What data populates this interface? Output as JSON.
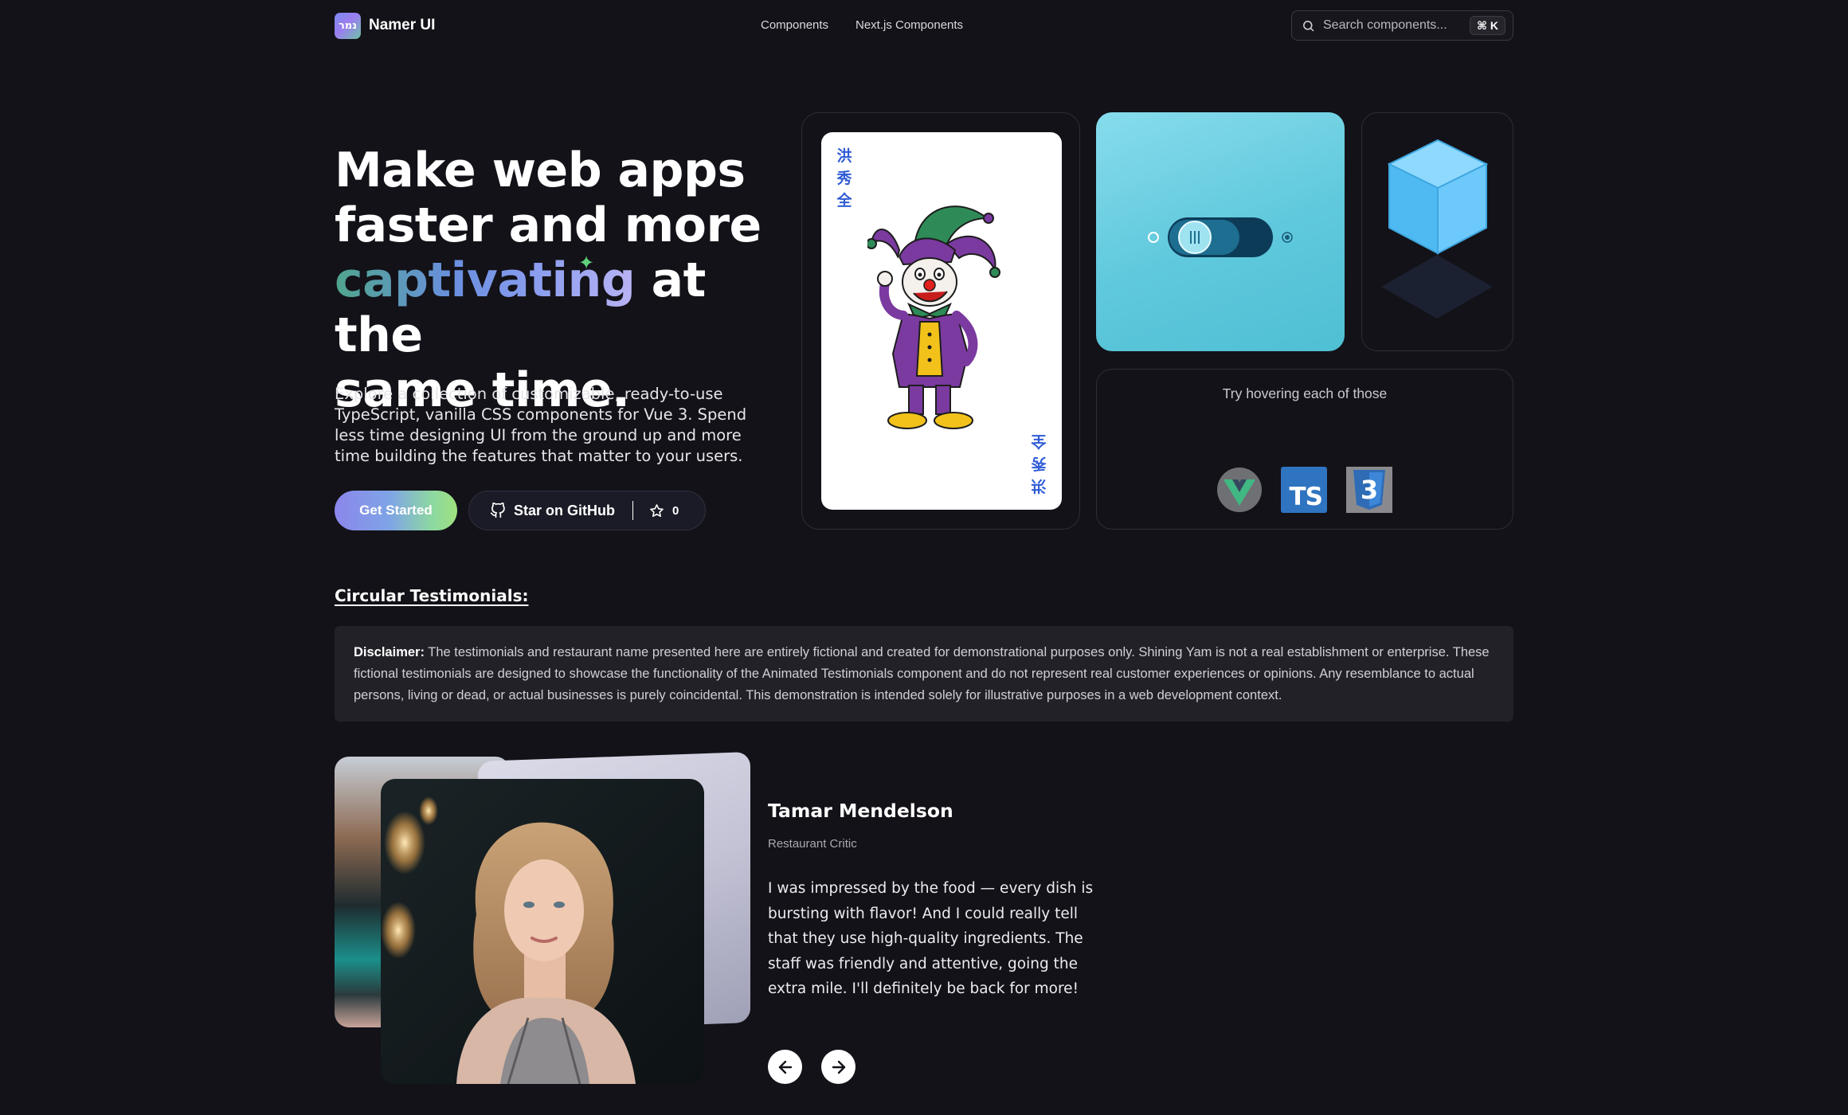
{
  "header": {
    "logo_glyph": "נמר",
    "brand": "Namer UI",
    "nav": [
      "Components",
      "Next.js Components"
    ],
    "search": {
      "placeholder": "Search components...",
      "shortcut": "⌘ K"
    }
  },
  "hero": {
    "title_line1": "Make web apps",
    "title_line2": "faster and more",
    "title_highlight": "captivating",
    "title_line3_rest": " at the",
    "title_line4": "same time.",
    "description": "Explore a collection of customizable, ready-to-use TypeScript, vanilla CSS components for Vue 3. Spend less time designing UI from the ground up and more time building the features that matter to your users.",
    "primary_button": "Get Started",
    "github_button": "Star on GitHub",
    "star_count": "0"
  },
  "showcase": {
    "card_top_chars": [
      "洪",
      "秀",
      "全"
    ],
    "card_bottom_chars": [
      "全",
      "秀",
      "洪"
    ],
    "hover_hint": "Try hovering each of those",
    "tech_icons": [
      "vue-icon",
      "typescript-icon",
      "css3-icon"
    ],
    "ts_label": "TS",
    "css_label": "3",
    "toggle": {
      "on": true
    }
  },
  "testimonials": {
    "section_title": "Circular Testimonials:",
    "disclaimer_label": "Disclaimer:",
    "disclaimer_text": " The testimonials and restaurant name presented here are entirely fictional and created for demonstrational purposes only. Shining Yam is not a real establishment or enterprise. These fictional testimonials are designed to showcase the functionality of the Animated Testimonials component and do not represent real customer experiences or opinions. Any resemblance to actual persons, living or dead, or actual businesses is purely coincidental. This demonstration is intended solely for illustrative purposes in a web development context.",
    "active": {
      "name": "Tamar Mendelson",
      "role": "Restaurant Critic",
      "quote": "I was impressed by the food — every dish is bursting with flavor! And I could really tell that they use high-quality ingredients. The staff was friendly and attentive, going the extra mile. I'll definitely be back for more!"
    }
  },
  "colors": {
    "background": "#131218",
    "accent_toggle_panel": "#5fc8dc",
    "ts_blue": "#2f74c0",
    "css_blue": "#2f6cb5",
    "vue_green": "#41b883"
  }
}
